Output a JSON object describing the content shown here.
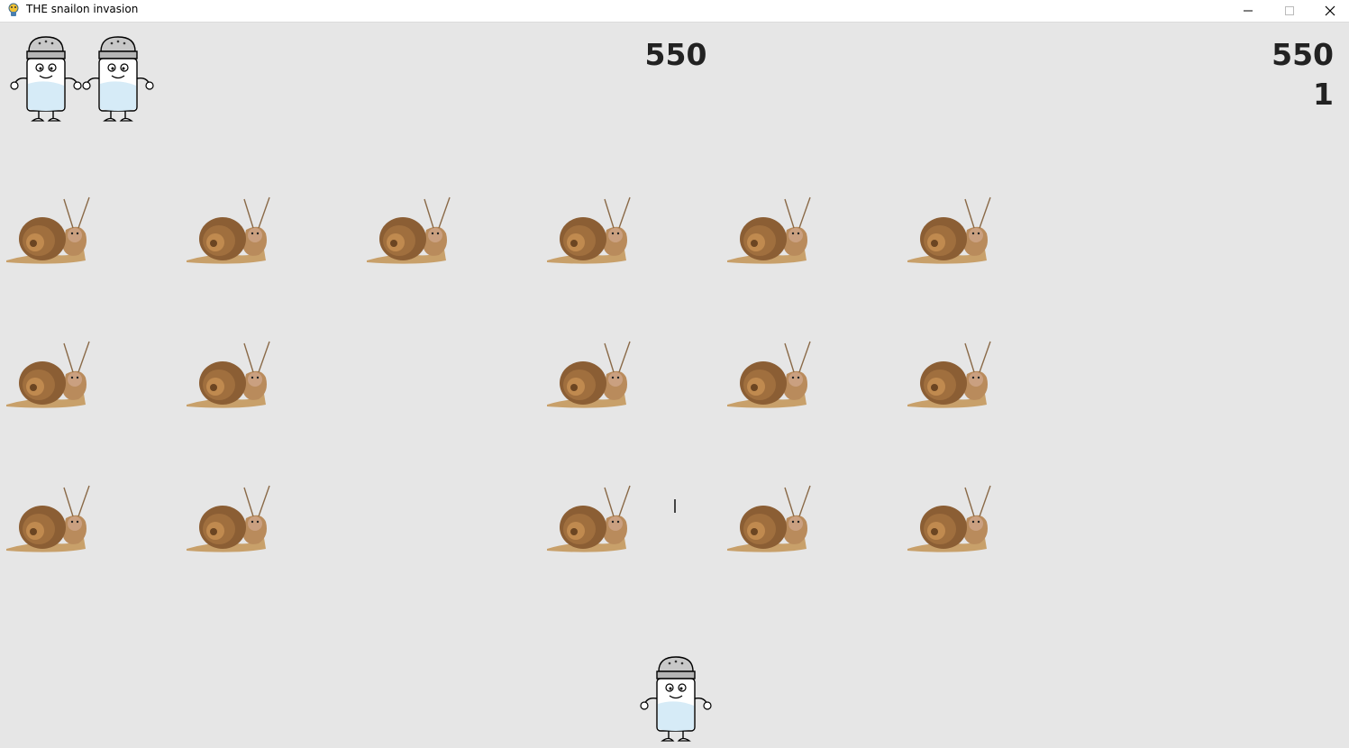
{
  "window": {
    "title": "THE snailon invasion",
    "app_icon": "pygame-snake-icon",
    "controls": [
      "minimize-icon",
      "maximize-icon",
      "close-icon"
    ]
  },
  "hud": {
    "score": "550",
    "high_score": "550",
    "level": "1",
    "lives_remaining": 2
  },
  "snail_grid": {
    "rows": 3,
    "columns": 6,
    "alive": [
      [
        true,
        true,
        true,
        true,
        true,
        true
      ],
      [
        true,
        true,
        false,
        true,
        true,
        true
      ],
      [
        true,
        true,
        false,
        true,
        true,
        true
      ]
    ]
  },
  "colors": {
    "background": "#e6e6e6",
    "text": "#222222"
  }
}
